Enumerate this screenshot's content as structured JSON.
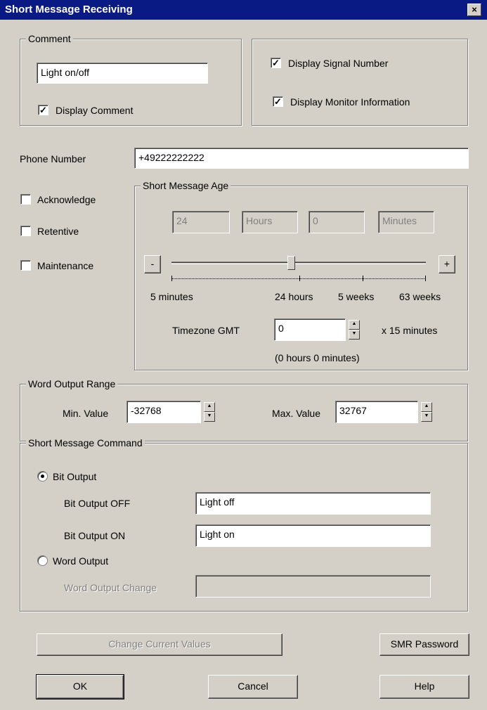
{
  "window": {
    "title": "Short Message Receiving",
    "close_glyph": "×"
  },
  "comment": {
    "legend": "Comment",
    "value": "Light on/off",
    "display_comment": {
      "label": "Display Comment",
      "checked": true
    }
  },
  "display": {
    "signal_number": {
      "label": "Display Signal Number",
      "checked": true
    },
    "monitor_information": {
      "label": "Display Monitor Information",
      "checked": true
    }
  },
  "phone": {
    "label": "Phone Number",
    "value": "+49222222222"
  },
  "options": {
    "acknowledge": {
      "label": "Acknowledge",
      "checked": false
    },
    "retentive": {
      "label": "Retentive",
      "checked": false
    },
    "maintenance": {
      "label": "Maintenance",
      "checked": false
    }
  },
  "age": {
    "legend": "Short Message Age",
    "hours_value": "24",
    "hours_unit": "Hours",
    "minutes_value": "0",
    "minutes_unit": "Minutes",
    "minus_label": "-",
    "plus_label": "+",
    "slider_position": 0.47,
    "scale": [
      "5 minutes",
      "24 hours",
      "5 weeks",
      "63 weeks"
    ],
    "timezone_label": "Timezone GMT",
    "timezone_value": "0",
    "timezone_unit": "x 15 minutes",
    "timezone_hint": "(0 hours 0 minutes)"
  },
  "word_range": {
    "legend": "Word Output Range",
    "min_label": "Min. Value",
    "min_value": "-32768",
    "max_label": "Max. Value",
    "max_value": "32767"
  },
  "command": {
    "legend": "Short Message Command",
    "bit_output": {
      "label": "Bit Output",
      "selected": true
    },
    "bit_off": {
      "label": "Bit Output OFF",
      "value": "Light off"
    },
    "bit_on": {
      "label": "Bit Output ON",
      "value": "Light on"
    },
    "word_output": {
      "label": "Word Output",
      "selected": false
    },
    "word_change": {
      "label": "Word Output Change",
      "value": ""
    }
  },
  "buttons": {
    "change_values": "Change Current Values",
    "smr_password": "SMR Password",
    "ok": "OK",
    "cancel": "Cancel",
    "help": "Help"
  },
  "colors": {
    "titlebar": "#0a1a84",
    "face": "#d4d0c8"
  }
}
